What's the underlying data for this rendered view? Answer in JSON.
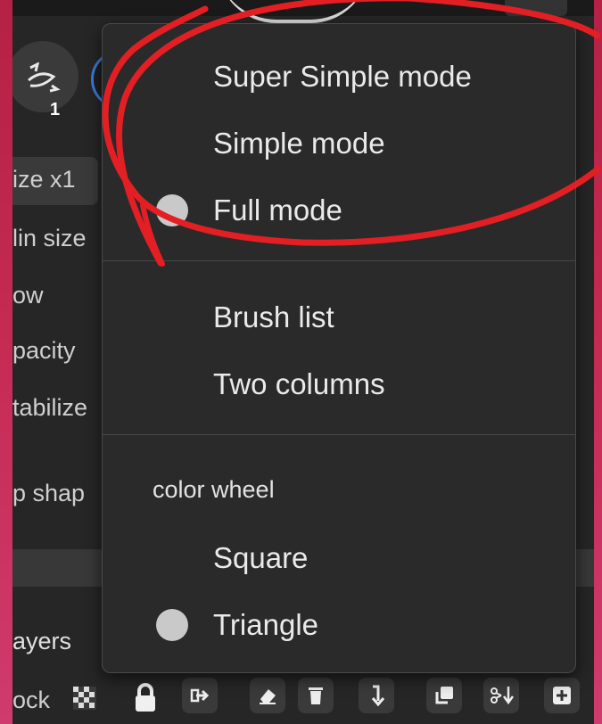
{
  "left_panel": {
    "brush_count": "1",
    "items": [
      {
        "label": "ize x1"
      },
      {
        "label": "lin size"
      },
      {
        "label": "ow"
      },
      {
        "label": "pacity"
      },
      {
        "label": "tabilize"
      },
      {
        "label": "p shap"
      }
    ]
  },
  "layers": {
    "title": "ayers",
    "lock_label": "ock"
  },
  "menu": {
    "mode_items": [
      {
        "label": "Super Simple mode",
        "selected": false
      },
      {
        "label": "Simple mode",
        "selected": false
      },
      {
        "label": "Full mode",
        "selected": true
      }
    ],
    "list_items": [
      {
        "label": "Brush list"
      },
      {
        "label": "Two columns"
      }
    ],
    "color_wheel": {
      "section_label": "color wheel",
      "items": [
        {
          "label": "Square",
          "selected": false
        },
        {
          "label": "Triangle",
          "selected": true
        }
      ]
    }
  },
  "colors": {
    "background": "#c22a50",
    "panel": "#262626",
    "menu": "#2a2a2a",
    "annotation": "#e31f24",
    "accent_blue": "#3d7bd9"
  },
  "icons": [
    "brush-tool-icon",
    "checker-icon",
    "lock-icon",
    "export-icon",
    "eraser-icon",
    "trash-icon",
    "merge-down-icon",
    "duplicate-icon",
    "cut-paste-icon",
    "add-layer-icon"
  ]
}
